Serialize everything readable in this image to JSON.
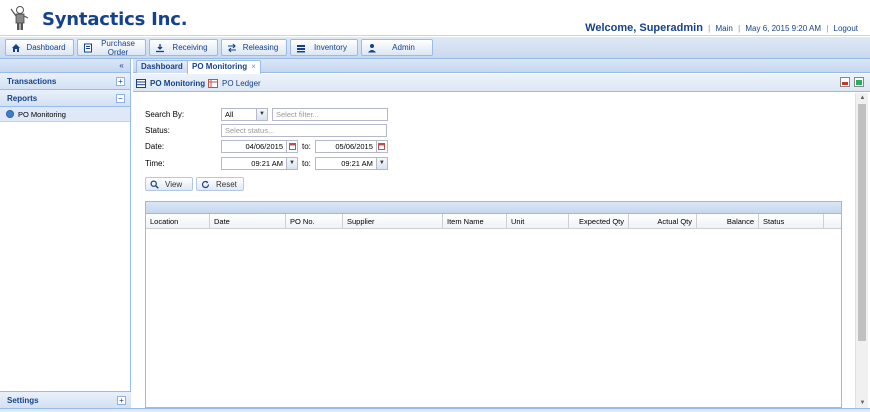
{
  "header": {
    "brand": "Syntactics Inc.",
    "welcome": "Welcome, Superadmin",
    "links": [
      "Main",
      "May 6, 2015 9:20 AM",
      "Logout"
    ]
  },
  "nav": [
    {
      "label": "Dashboard",
      "icon": "home-icon"
    },
    {
      "label": "Purchase Order",
      "icon": "document-icon"
    },
    {
      "label": "Receiving",
      "icon": "download-icon"
    },
    {
      "label": "Releasing",
      "icon": "transfer-icon"
    },
    {
      "label": "Inventory",
      "icon": "stack-icon"
    },
    {
      "label": "Admin",
      "icon": "user-icon"
    }
  ],
  "sidebar": {
    "collapse_glyph": "«",
    "sections": {
      "transactions": "Transactions",
      "reports": "Reports",
      "settings": "Settings"
    },
    "items": [
      {
        "label": "PO Monitoring"
      }
    ]
  },
  "tabs": [
    {
      "label": "Dashboard"
    },
    {
      "label": "PO Monitoring",
      "close": "×"
    }
  ],
  "subtabs": [
    {
      "label": "PO Monitoring"
    },
    {
      "label": "PO Ledger"
    }
  ],
  "form": {
    "search_by_label": "Search By:",
    "search_by_value": "All",
    "filter_placeholder": "Select filter...",
    "status_label": "Status:",
    "status_placeholder": "Select status...",
    "date_label": "Date:",
    "date_from": "04/06/2015",
    "date_to": "05/06/2015",
    "time_label": "Time:",
    "time_from": "09:21 AM",
    "time_to": "09:21 AM",
    "to_label": "to:",
    "view_button": "View",
    "reset_button": "Reset"
  },
  "grid": {
    "columns": [
      "Location",
      "Date",
      "PO No.",
      "Supplier",
      "Item Name",
      "Unit",
      "Expected Qty",
      "Actual Qty",
      "Balance",
      "Status"
    ]
  },
  "colors": {
    "accent": "#15428b",
    "border": "#99bbe8",
    "panel": "#dfe8f6"
  }
}
